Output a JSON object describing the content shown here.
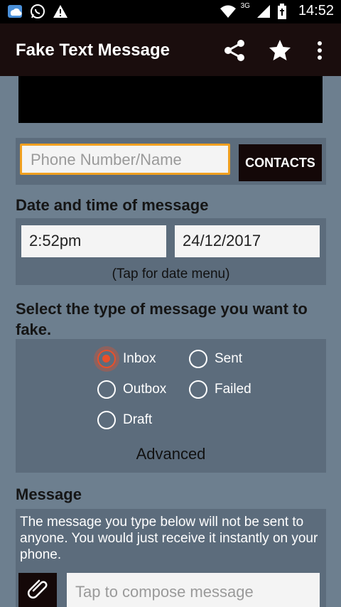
{
  "status_bar": {
    "time": "14:52",
    "network_label": "3G",
    "icons": [
      "weather-icon",
      "whatsapp-icon",
      "warning-icon",
      "wifi-icon",
      "signal-icon",
      "battery-icon"
    ]
  },
  "app_bar": {
    "title": "Fake Text Message",
    "actions": [
      "share-icon",
      "star-icon",
      "overflow-menu-icon"
    ]
  },
  "recipient": {
    "placeholder": "Phone Number/Name",
    "contacts_label": "CONTACTS"
  },
  "datetime": {
    "heading": "Date and time of message",
    "time_value": "2:52pm",
    "date_value": "24/12/2017",
    "hint": "(Tap for date menu)"
  },
  "message_type": {
    "heading": "Select the type of message you want to fake.",
    "options": [
      {
        "label": "Inbox",
        "checked": true
      },
      {
        "label": "Sent",
        "checked": false
      },
      {
        "label": "Outbox",
        "checked": false
      },
      {
        "label": "Failed",
        "checked": false
      },
      {
        "label": "Draft",
        "checked": false
      }
    ],
    "advanced_label": "Advanced"
  },
  "message": {
    "heading": "Message",
    "info": "The message you type below will not be sent to anyone. You would just receive it instantly on your phone.",
    "compose_placeholder": "Tap to compose message"
  },
  "colors": {
    "background": "#6d7f8f",
    "panel": "#5c6c7c",
    "app_bar": "#1a0d0d",
    "accent_focus": "#f0a020",
    "radio_checked": "#e8502a"
  }
}
